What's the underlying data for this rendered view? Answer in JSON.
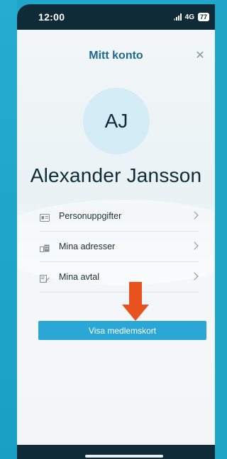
{
  "status_bar": {
    "time": "12:00",
    "network": "4G",
    "battery": "77"
  },
  "header": {
    "title": "Mitt konto",
    "close_icon": "close-icon"
  },
  "profile": {
    "initials": "AJ",
    "name": "Alexander Jansson"
  },
  "menu": {
    "items": [
      {
        "label": "Personuppgifter",
        "icon": "id-card-icon"
      },
      {
        "label": "Mina adresser",
        "icon": "buildings-icon"
      },
      {
        "label": "Mina avtal",
        "icon": "contract-pen-icon"
      }
    ]
  },
  "actions": {
    "show_card_label": "Visa medlemskort"
  },
  "colors": {
    "accent": "#2aa7d4",
    "title": "#1c6a8e",
    "dark_bar": "#0f2b37",
    "arrow": "#e8521e",
    "avatar_bg": "#d4ecf5"
  }
}
